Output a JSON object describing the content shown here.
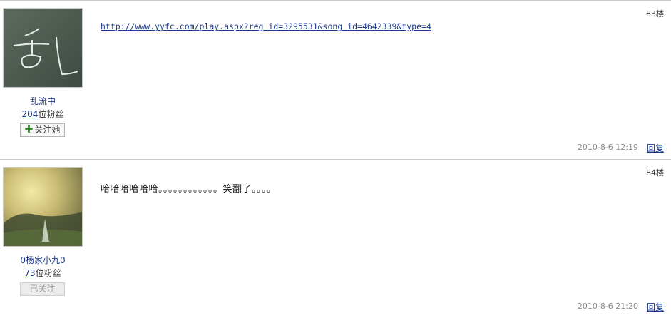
{
  "posts": [
    {
      "floor": "83楼",
      "user": {
        "name": "乱流中",
        "fans_count": "204",
        "fans_suffix": "位粉丝"
      },
      "follow": {
        "icon": "plus-icon",
        "label": "关注她",
        "state": "not-followed"
      },
      "content": {
        "link": "http://www.yyfc.com/play.aspx?reg_id=3295531&song_id=4642339&type=4"
      },
      "time": "2010-8-6 12:19",
      "reply_label": "回复"
    },
    {
      "floor": "84楼",
      "user": {
        "name": "0杨家小九0",
        "fans_count": "73",
        "fans_suffix": "位粉丝"
      },
      "follow": {
        "label": "已关注",
        "state": "followed"
      },
      "content": {
        "text": "哈哈哈哈哈哈。。。。。。。。。。。。笑翻了。。。。"
      },
      "time": "2010-8-6 21:20",
      "reply_label": "回复"
    }
  ]
}
